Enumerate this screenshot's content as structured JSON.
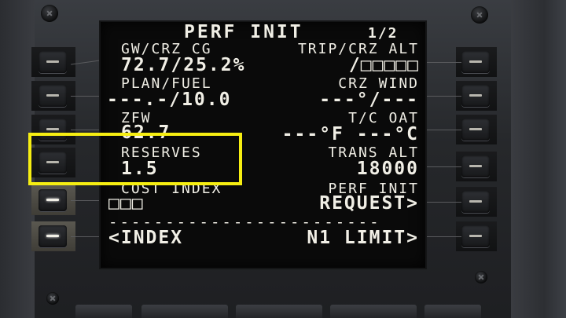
{
  "page": {
    "title": "PERF INIT",
    "page_number": "1/2"
  },
  "left_fields": [
    {
      "label": "GW/CRZ CG",
      "value": "72.7/25.2%"
    },
    {
      "label": "PLAN/FUEL",
      "value": "---.-/10.0"
    },
    {
      "label": "ZFW",
      "value": "62.7"
    },
    {
      "label": "RESERVES",
      "value": "1.5"
    },
    {
      "label": "COST INDEX",
      "value": "□□□"
    },
    {
      "label": "",
      "value": "<INDEX"
    }
  ],
  "right_fields": [
    {
      "label": "TRIP/CRZ ALT",
      "value": "/□□□□□"
    },
    {
      "label": "CRZ WIND",
      "value": "---°/---"
    },
    {
      "label": "T/C OAT",
      "value": "---°F ---°C"
    },
    {
      "label": "TRANS ALT",
      "value": "18000"
    },
    {
      "label": "PERF INIT",
      "value": "REQUEST>"
    },
    {
      "label": "",
      "value": "N1 LIMIT>"
    }
  ],
  "separator": "------------------------",
  "highlight_color": "#f6ee12",
  "icons": [
    "screw-icon",
    "line-select-key-icon"
  ]
}
